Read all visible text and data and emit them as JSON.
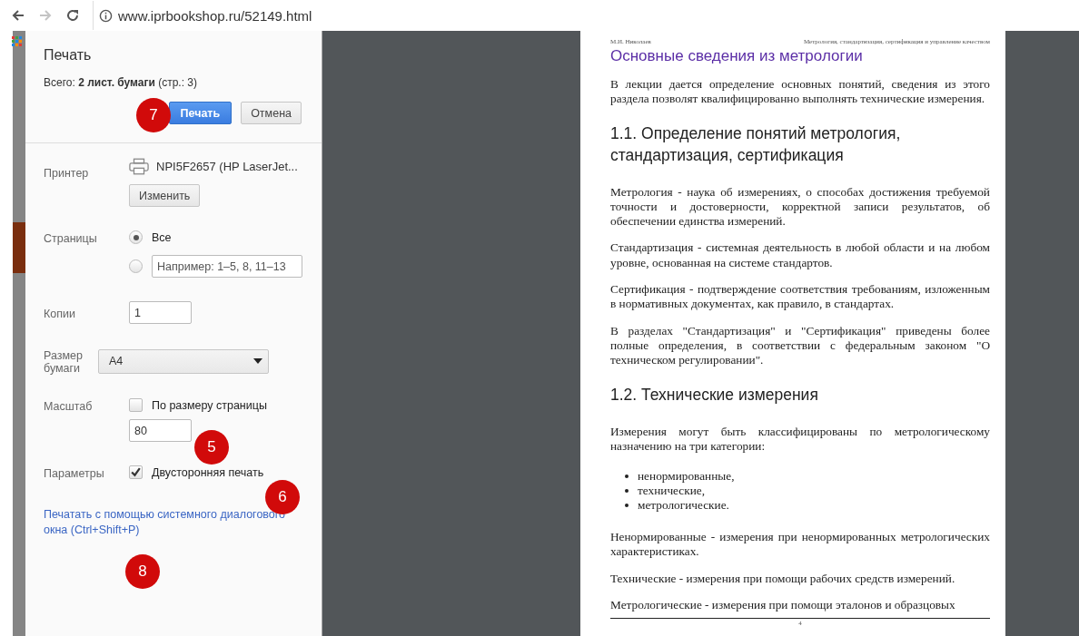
{
  "browser": {
    "url": "www.iprbookshop.ru/52149.html"
  },
  "print": {
    "title": "Печать",
    "total": "Всего: **2 лист. бумаги** (стр.: 3)",
    "buttons": [
      {
        "label": "Печать",
        "kind": "primary"
      },
      {
        "label": "Отмена",
        "kind": "default"
      }
    ]
  },
  "settings": {
    "printer": {
      "label": "Принтер",
      "name": "NPI5F2657 (HP LaserJet...",
      "change_button": "Изменить"
    },
    "pages": {
      "label": "Страницы",
      "options": [
        {
          "kind": "all",
          "label": "Все",
          "selected": true
        },
        {
          "kind": "range",
          "placeholder": "Например: 1–5, 8, 11–13",
          "selected": false
        }
      ]
    },
    "copies": {
      "label": "Копии",
      "value": "1"
    },
    "paper_size": {
      "label": "Размер бумаги",
      "value": "A4"
    },
    "scale": {
      "label": "Масштаб",
      "fit_label": "По размеру страницы",
      "fit_checked": false,
      "value": "80"
    },
    "options": {
      "label": "Параметры",
      "duplex_label": "Двусторонняя печать",
      "duplex_checked": true
    },
    "system_dialog_link": "Печатать с помощью системного диалогового окна (Ctrl+Shift+P)"
  },
  "markers": [
    {
      "label": "7"
    },
    {
      "label": "5"
    },
    {
      "label": "6"
    },
    {
      "label": "8"
    }
  ],
  "preview": {
    "header_left": "М.И. Николаев",
    "header_right": "Метрология, стандартизация, сертификация и управление качеством",
    "page_number": "4",
    "blocks": [
      {
        "kind": "title",
        "text": "Основные сведения из метрологии"
      },
      {
        "kind": "para",
        "text": "В лекции дается определение основных понятий, сведения из этого раздела позволят квалифицированно выполнять технические измерения."
      },
      {
        "kind": "heading",
        "text": "1.1. Определение понятий метрология, стандартизация, сертификация"
      },
      {
        "kind": "para",
        "text": "Метрология - наука об измерениях, о способах достижения требуемой точности и достоверности, корректной записи результатов, об обеспечении единства измерений."
      },
      {
        "kind": "para",
        "text": "Стандартизация - системная деятельность в любой области и на любом уровне, основанная на системе стандартов."
      },
      {
        "kind": "para",
        "text": "Сертификация - подтверждение соответствия требованиям, изложенным в нормативных документах, как правило, в стандартах."
      },
      {
        "kind": "para",
        "text": "В разделах \"Стандартизация\" и \"Сертификация\" приведены более полные определения, в соответствии с федеральным законом \"О техническом регулировании\"."
      },
      {
        "kind": "heading",
        "text": "1.2. Технические измерения"
      },
      {
        "kind": "para",
        "text": "Измерения могут быть классифицированы по метрологическому назначению на три категории:"
      },
      {
        "kind": "list",
        "items": [
          "ненормированные,",
          "технические,",
          "метрологические."
        ]
      },
      {
        "kind": "para",
        "text": "Ненормированные - измерения при ненормированных метрологических характеристиках."
      },
      {
        "kind": "para",
        "text": "Технические - измерения при помощи рабочих средств измерений."
      },
      {
        "kind": "para",
        "text": "Метрологические - измерения при помощи эталонов и образцовых"
      }
    ]
  }
}
